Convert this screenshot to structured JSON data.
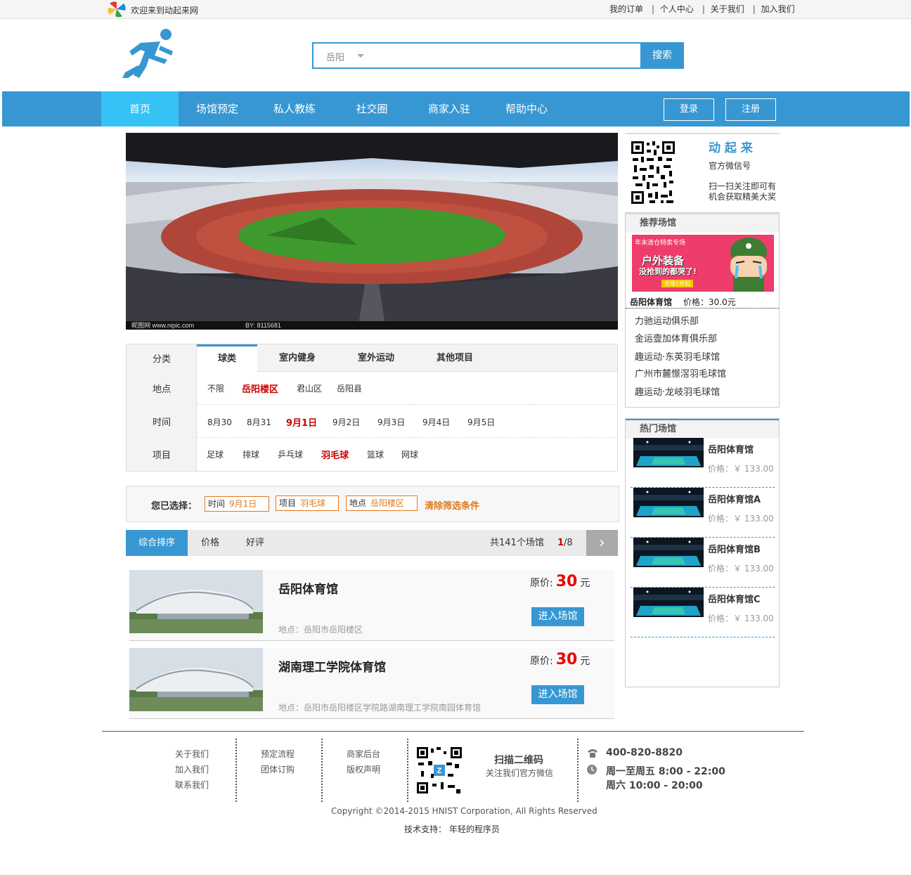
{
  "topbar": {
    "welcome": "欢迎来到动起来网",
    "links": [
      "我的订单",
      "个人中心",
      "关于我们",
      "加入我们"
    ],
    "separator": "|"
  },
  "search": {
    "city": "岳阳",
    "button": "搜索"
  },
  "nav": {
    "items": [
      "首页",
      "场馆预定",
      "私人教练",
      "社交圈",
      "商家入驻",
      "帮助中心"
    ],
    "active": "首页",
    "login": "登录",
    "register": "注册"
  },
  "banner": {
    "watermark": "昵图网 www.nipic.com",
    "watermark_id": "BY: 8115681"
  },
  "filter": {
    "category_label": "分类",
    "tabs": [
      "球类",
      "室内健身",
      "室外运动",
      "其他项目"
    ],
    "active_tab": "球类",
    "location_label": "地点",
    "locations": [
      "不限",
      "岳阳楼区",
      "君山区",
      "岳阳县"
    ],
    "location_selected": "岳阳楼区",
    "time_label": "时间",
    "times": [
      "8月30",
      "8月31",
      "9月1日",
      "9月2日",
      "9月3日",
      "9月4日",
      "9月5日"
    ],
    "time_selected": "9月1日",
    "sport_label": "项目",
    "sports": [
      "足球",
      "排球",
      "乒乓球",
      "羽毛球",
      "篮球",
      "网球"
    ],
    "sport_selected": "羽毛球"
  },
  "chosen": {
    "label": "您已选择：",
    "chips": [
      {
        "k": "时间",
        "v": "9月1日"
      },
      {
        "k": "项目",
        "v": "羽毛球"
      },
      {
        "k": "地点",
        "v": "岳阳楼区"
      }
    ],
    "clear": "清除筛选条件"
  },
  "sort": {
    "options": [
      "综合排序",
      "价格",
      "好评"
    ],
    "total": "共141个场馆",
    "page_current": "1",
    "page_total": "/8",
    "next": "›"
  },
  "venues": [
    {
      "name": "岳阳体育馆",
      "addr": "地点：岳阳市岳阳楼区",
      "price_label": "原价:",
      "price": "30",
      "unit": "元",
      "enter": "进入场馆"
    },
    {
      "name": "湖南理工学院体育馆",
      "addr": "地点：岳阳市岳阳楼区学院路湖南理工学院南园体育馆",
      "price_label": "原价:",
      "price": "30",
      "unit": "元",
      "enter": "进入场馆"
    }
  ],
  "qr": {
    "title": "动 起 来",
    "sub": "官方微信号",
    "line1": "扫一扫关注即可有",
    "line2": "机会获取精美大奖"
  },
  "recommend": {
    "title": "推荐场馆",
    "ad_top": "年末清仓特卖专场",
    "ad_line1": "户外装备",
    "ad_line2": "没抢到的都哭了!",
    "ad_sale": "全场1折起",
    "venue": "岳阳体育馆",
    "price": "价格：30.0元",
    "list": [
      "力驰运动俱乐部",
      "金运壹加体育俱乐部",
      "趣运动·东英羽毛球馆",
      "广州市麓憬滘羽毛球馆",
      "趣运动·龙岐羽毛球馆"
    ]
  },
  "hot": {
    "title": "热门场馆",
    "items": [
      {
        "name": "岳阳体育馆",
        "price": "价格：￥  133.00"
      },
      {
        "name": "岳阳体育馆A",
        "price": "价格：￥  133.00"
      },
      {
        "name": "岳阳体育馆B",
        "price": "价格：￥  133.00"
      },
      {
        "name": "岳阳体育馆C",
        "price": "价格：￥  133.00"
      }
    ]
  },
  "footer": {
    "col1": [
      "关于我们",
      "加入我们",
      "联系我们"
    ],
    "col2": [
      "预定流程",
      "团体订购"
    ],
    "col3": [
      "商家后台",
      "版权声明"
    ],
    "scan": "扫描二维码",
    "scan_sub": "关注我们官方微信",
    "phone": "400-820-8820",
    "hours1": "周一至周五  8:00 - 22:00",
    "hours2": "周六  10:00 - 20:00",
    "copyright": "Copyright ©2014-2015 HNIST Corporation, All Rights Reserved",
    "tech": "技术支持：  年轻的程序员"
  },
  "colors": {
    "accent": "#3797d2",
    "active_nav": "#34c3f4",
    "red": "#cc0000",
    "orange": "#e07a1f"
  }
}
